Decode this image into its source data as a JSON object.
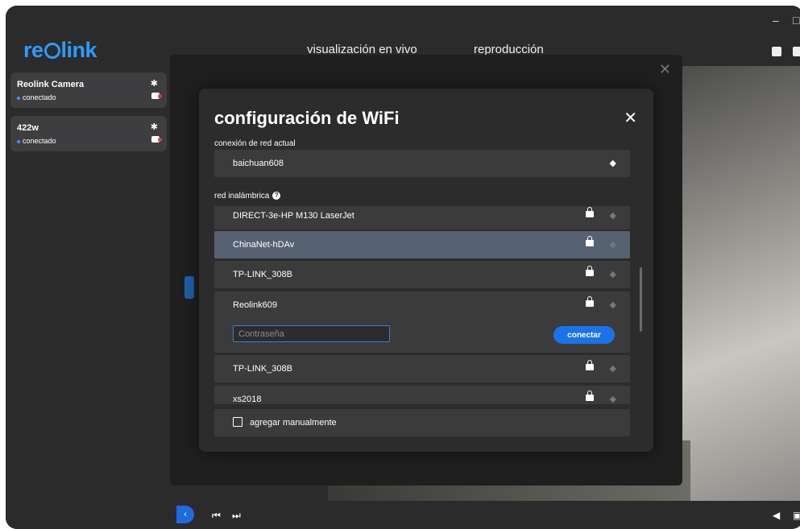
{
  "app": {
    "logo": "reolink",
    "nav": {
      "live": "visualización en vivo",
      "playback": "reproducción"
    }
  },
  "window_controls": {
    "minimize": "–",
    "maximize": "□"
  },
  "devices": [
    {
      "name": "Reolink Camera",
      "status": "conectado"
    },
    {
      "name": "422w",
      "status": "conectado"
    }
  ],
  "wifi_dialog": {
    "title": "configuración de WiFi",
    "close": "✕",
    "current_label": "conexión de red actual",
    "current_network": "baichuan608",
    "wireless_label": "red inalámbrica",
    "networks": [
      {
        "ssid": "DIRECT-3e-HP M130 LaserJet"
      },
      {
        "ssid": "ChinaNet-hDAv"
      },
      {
        "ssid": "TP-LINK_308B"
      },
      {
        "ssid": "Reolink609"
      },
      {
        "ssid": "TP-LINK_308B"
      },
      {
        "ssid": "xs2018"
      }
    ],
    "password_placeholder": "Contraseña",
    "connect_label": "conectar",
    "add_manually": "agregar manualmente"
  },
  "outer_dialog": {
    "close": "✕"
  },
  "colors": {
    "accent": "#1a73e8",
    "selected_row": "#566172",
    "dialog_bg": "#2c2c2d"
  }
}
